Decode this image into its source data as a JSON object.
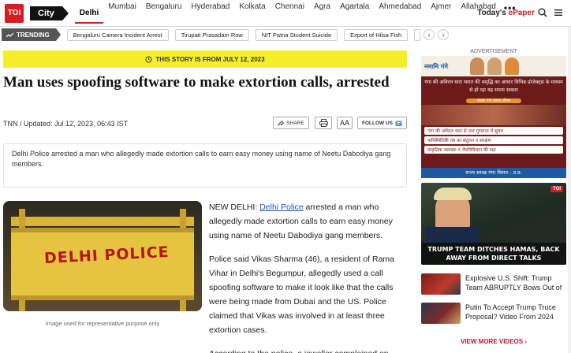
{
  "topnav": {
    "logo": "TOI",
    "city_tab": "City",
    "cities": [
      "Delhi",
      "Mumbai",
      "Bengaluru",
      "Hyderabad",
      "Kolkata",
      "Chennai",
      "Agra",
      "Agartala",
      "Ahmedabad",
      "Ajmer",
      "Allahabad"
    ],
    "more": "•••",
    "epaper_prefix": "Today's ",
    "epaper_word": "ePaper"
  },
  "trending": {
    "label": "TRENDING",
    "items": [
      "Bengaluru Camera Incident Arrest",
      "Tirupati Prasadam Row",
      "NIT Patna Student Suicide",
      "Export of Hilsa Fish"
    ]
  },
  "story": {
    "banner": "THIS STORY IS FROM JULY 12, 2023",
    "headline": "Man uses spoofing software to make extortion calls, arrested",
    "byline": "TNN / Updated: Jul 12, 2023, 06:43 IST",
    "share_label": "SHARE",
    "font_label": "AA",
    "follow_label": "FOLLOW US",
    "summary": "Delhi Police arrested a man who allegedly made extortion calls to earn easy money using name of Neetu Dabodiya gang members.",
    "image_caption": "Image used for representative purpose only",
    "image_text": "DELHI POLICE",
    "para1_prefix": "NEW DELHI: ",
    "para1_link": "Delhi Police",
    "para1_rest": " arrested a man who allegedly made extortion calls to earn easy money using name of Neetu Dabodiya gang members.",
    "para2": "Police said Vikas Sharma (46), a resident of Rama Vihar in Delhi's Begumpur, allegedly used a call spoofing software to make it look like that the calls were being made from Dubai and the US. Police claimed that Vikas was involved in at least three extortion cases.",
    "para3": "According to the police, a jeweller complained on"
  },
  "sidebar": {
    "ad_label": "ADVERTISEMENT",
    "ad_logo": "नमामि गंगे",
    "ad_headline": "गंगा की अविरल धारा भारत की समृद्धि का आधार विभिन्न प्रोजेक्ट्स के माध्यम से हो रहा यह सपना साकार",
    "ad_sub": "स्वच्छ गंगा स्वस्थ जीवन",
    "ad_points": [
      "गंगा की अविरल धारा से जल गुणवत्ता में सुधार",
      "पारिस्थितिकी तंत्र का संतुलन व संरक्षण",
      "प्राकृतिक जलचक्र व जैवविविधता की रक्षा"
    ],
    "ad_footer": "राज्य स्वच्छ गंगा मिशन - उ.प्र.",
    "video_badge": "TOI",
    "video_title": "TRUMP TEAM DITCHES HAMAS, BACK AWAY FROM DIRECT TALKS",
    "items": [
      {
        "title": "Explosive U.S. Shift: Trump Team ABRUPTLY Bows Out of"
      },
      {
        "title": "Putin To Accept Trump Truce Proposal? Video From 2024"
      }
    ],
    "view_more": "VIEW MORE VIDEOS"
  },
  "colors": {
    "brand_red": "#d71c22",
    "banner_yellow": "#f4ef2a",
    "link_blue": "#1a57b7"
  }
}
